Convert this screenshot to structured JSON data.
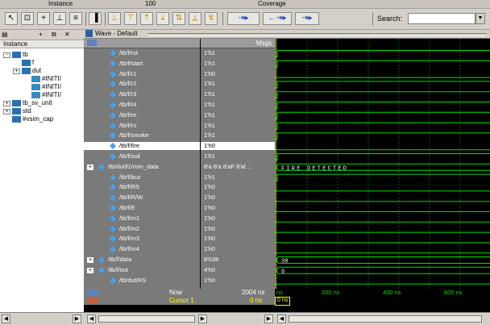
{
  "topstrip": {
    "text1": "Instance",
    "text2": "100",
    "text3": "Coverage"
  },
  "search": {
    "label": "Search:",
    "value": ""
  },
  "instance_panel": {
    "header": "",
    "column": "Instance",
    "items": [
      {
        "label": "tb",
        "indent": 0,
        "expander": "-"
      },
      {
        "label": "f",
        "indent": 1,
        "expander": ""
      },
      {
        "label": "dut",
        "indent": 1,
        "expander": "+"
      },
      {
        "label": "#INITI/",
        "indent": 2,
        "expander": ""
      },
      {
        "label": "#INITI/",
        "indent": 2,
        "expander": ""
      },
      {
        "label": "#INITI/",
        "indent": 2,
        "expander": ""
      },
      {
        "label": "tb_sv_unit",
        "indent": 0,
        "expander": "+"
      },
      {
        "label": "std",
        "indent": 0,
        "expander": "+"
      },
      {
        "label": "#vsim_cap",
        "indent": 0,
        "expander": ""
      }
    ]
  },
  "wave": {
    "title": "Wave - Default",
    "msgs_label": "Msgs",
    "signals": [
      {
        "name": "/tb/f/rst",
        "value": "1'h1",
        "expand": false,
        "selected": false
      },
      {
        "name": "/tb/f/start",
        "value": "1'h1",
        "expand": false,
        "selected": false
      },
      {
        "name": "/tb/f/r1",
        "value": "1'h0",
        "expand": false,
        "selected": false
      },
      {
        "name": "/tb/f/r2",
        "value": "1'h1",
        "expand": false,
        "selected": false
      },
      {
        "name": "/tb/f/r3",
        "value": "1'h1",
        "expand": false,
        "selected": false
      },
      {
        "name": "/tb/f/r4",
        "value": "1'h1",
        "expand": false,
        "selected": false
      },
      {
        "name": "/tb/f/re",
        "value": "1'h1",
        "expand": false,
        "selected": false
      },
      {
        "name": "/tb/f/ro",
        "value": "1'h1",
        "expand": false,
        "selected": false
      },
      {
        "name": "/tb/f/smoke",
        "value": "1'h1",
        "expand": false,
        "selected": false
      },
      {
        "name": "/tb/f/fire",
        "value": "1'h0",
        "expand": false,
        "selected": true
      },
      {
        "name": "/tb/f/soil",
        "value": "1'h1",
        "expand": false,
        "selected": false
      },
      {
        "name": "/tb/dut/l1/rom_data",
        "value": "8'a 8'a 8'aF 8'al ...",
        "expand": true,
        "selected": false
      },
      {
        "name": "/tb/f/buz",
        "value": "1'h1",
        "expand": false,
        "selected": false
      },
      {
        "name": "/tb/f/RS",
        "value": "1'h0",
        "expand": false,
        "selected": false
      },
      {
        "name": "/tb/f/R/W",
        "value": "1'h0",
        "expand": false,
        "selected": false
      },
      {
        "name": "/tb/f/E",
        "value": "1'h0",
        "expand": false,
        "selected": false
      },
      {
        "name": "/tb/f/m1",
        "value": "1'h0",
        "expand": false,
        "selected": false
      },
      {
        "name": "/tb/f/m2",
        "value": "1'h0",
        "expand": false,
        "selected": false
      },
      {
        "name": "/tb/f/m3",
        "value": "1'h0",
        "expand": false,
        "selected": false
      },
      {
        "name": "/tb/f/m4",
        "value": "1'h0",
        "expand": false,
        "selected": false
      },
      {
        "name": "/tb/f/data",
        "value": "8'h38",
        "expand": true,
        "selected": false
      },
      {
        "name": "/tb/f/out",
        "value": "4'h0",
        "expand": true,
        "selected": false
      },
      {
        "name": "/tb/dut/RS",
        "value": "1'h0",
        "expand": false,
        "selected": false
      }
    ],
    "rom_data_text": "FIRE DETECTED",
    "data_bus_text": "38",
    "out_bus_text": "0",
    "now_label": "Now",
    "now_value": "2004 ns",
    "cursor_label": "Cursor 1",
    "cursor_value": "0 ns",
    "cursor_marker": "0 ns",
    "time_ticks": [
      "ns",
      "200 ns",
      "400 ns",
      "600 ns"
    ]
  },
  "colors": {
    "wave_green": "#00e000",
    "grid_green": "#006000",
    "signal_bg": "#7a7a7a",
    "cursor_yellow": "#ffff00"
  }
}
